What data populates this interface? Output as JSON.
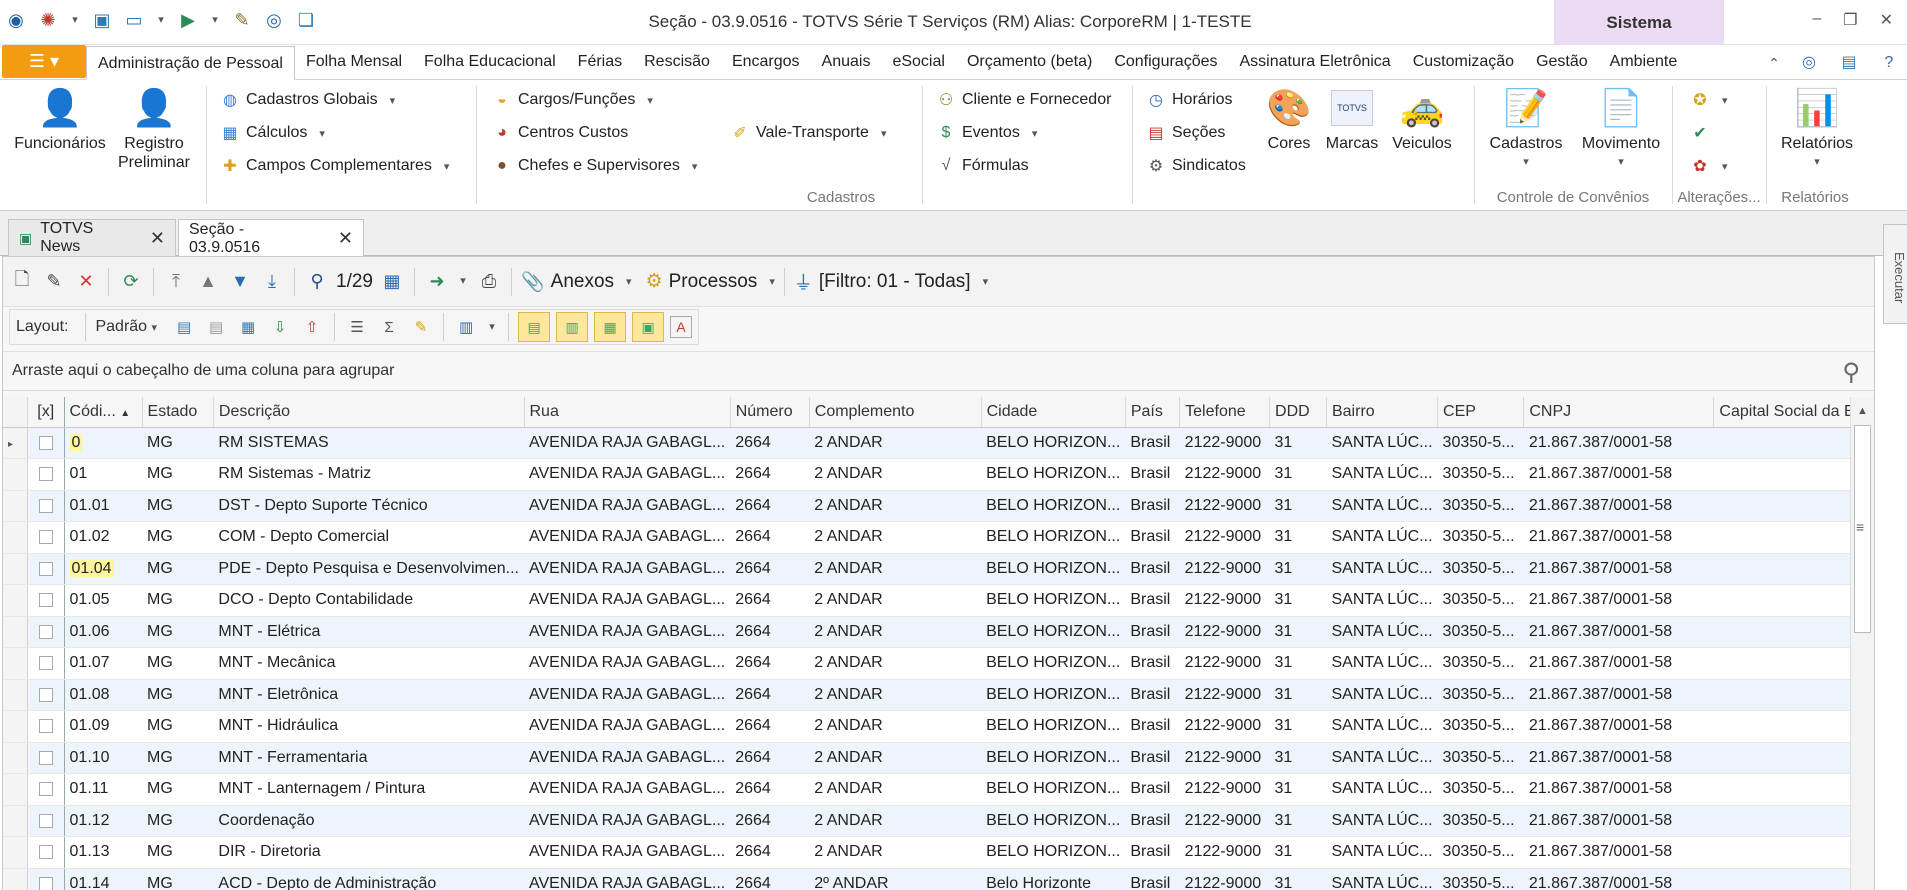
{
  "window": {
    "title": "Seção - 03.9.0516 - TOTVS Série T Serviços (RM) Alias: CorporeRM | 1-TESTE",
    "context_tab": "Sistema",
    "controls": [
      "–",
      "❐",
      "✕"
    ]
  },
  "ribbon_tabs": [
    {
      "label": "Administração de Pessoal",
      "active": true
    },
    {
      "label": "Folha Mensal"
    },
    {
      "label": "Folha Educacional"
    },
    {
      "label": "Férias"
    },
    {
      "label": "Rescisão"
    },
    {
      "label": "Encargos"
    },
    {
      "label": "Anuais"
    },
    {
      "label": "eSocial"
    },
    {
      "label": "Orçamento (beta)"
    },
    {
      "label": "Configurações"
    },
    {
      "label": "Assinatura Eletrônica"
    },
    {
      "label": "Customização"
    },
    {
      "label": "Gestão"
    },
    {
      "label": "Ambiente"
    }
  ],
  "ribbon": {
    "funcionarios": "Funcionários",
    "registro": "Registro\nPreliminar",
    "cadastros_globais": "Cadastros Globais",
    "calculos": "Cálculos",
    "campos_complementares": "Campos Complementares",
    "cargos_funcoes": "Cargos/Funções",
    "centros_custos": "Centros Custos",
    "chefes_supervisores": "Chefes e Supervisores",
    "vale_transporte": "Vale-Transporte",
    "cliente_fornecedor": "Cliente e Fornecedor",
    "eventos": "Eventos",
    "formulas": "Fórmulas",
    "horarios": "Horários",
    "secoes": "Seções",
    "sindicatos": "Sindicatos",
    "cores": "Cores",
    "marcas": "Marcas",
    "veiculos": "Veiculos",
    "marcas_logo": "TOTVS",
    "group_cadastros": "Cadastros",
    "cadastros_btn": "Cadastros",
    "movimento_btn": "Movimento",
    "group_convenios": "Controle de Convênios",
    "group_alteracoes": "Alterações...",
    "relatorios_btn": "Relatórios",
    "group_relatorios": "Relatórios"
  },
  "doc_tabs": [
    {
      "label": "TOTVS News",
      "active": false
    },
    {
      "label": "Seção - 03.9.0516",
      "active": true
    }
  ],
  "side_panel": "Executar",
  "toolbar": {
    "pager": "1/29",
    "anexos": "Anexos",
    "processos": "Processos",
    "filtro": "[Filtro: 01 - Todas]",
    "layout_label": "Layout:",
    "layout_value": "Padrão"
  },
  "group_prompt": "Arraste aqui o cabeçalho de uma coluna para agrupar",
  "grid": {
    "columns": [
      "[x]",
      "Códi...",
      "Estado",
      "Descrição",
      "Rua",
      "Número",
      "Complemento",
      "Cidade",
      "País",
      "Telefone",
      "DDD",
      "Bairro",
      "CEP",
      "CNPJ",
      "Capital Social da Em"
    ],
    "rows": [
      {
        "codigo": "0",
        "estado": "MG",
        "descricao": "RM SISTEMAS",
        "rua": "AVENIDA RAJA GABAGL...",
        "numero": "2664",
        "complemento": "2 ANDAR",
        "cidade": "BELO HORIZON...",
        "pais": "Brasil",
        "telefone": "2122-9000",
        "ddd": "31",
        "bairro": "SANTA LÚC...",
        "cep": "30350-5...",
        "cnpj": "21.867.387/0001-58",
        "highlight": true,
        "current": true
      },
      {
        "codigo": "01",
        "estado": "MG",
        "descricao": "RM Sistemas - Matriz",
        "rua": "AVENIDA RAJA GABAGL...",
        "numero": "2664",
        "complemento": "2 ANDAR",
        "cidade": "BELO HORIZON...",
        "pais": "Brasil",
        "telefone": "2122-9000",
        "ddd": "31",
        "bairro": "SANTA LÚC...",
        "cep": "30350-5...",
        "cnpj": "21.867.387/0001-58"
      },
      {
        "codigo": "01.01",
        "estado": "MG",
        "descricao": "DST - Depto Suporte Técnico",
        "rua": "AVENIDA RAJA GABAGL...",
        "numero": "2664",
        "complemento": "2 ANDAR",
        "cidade": "BELO HORIZON...",
        "pais": "Brasil",
        "telefone": "2122-9000",
        "ddd": "31",
        "bairro": "SANTA LÚC...",
        "cep": "30350-5...",
        "cnpj": "21.867.387/0001-58"
      },
      {
        "codigo": "01.02",
        "estado": "MG",
        "descricao": "COM - Depto Comercial",
        "rua": "AVENIDA RAJA GABAGL...",
        "numero": "2664",
        "complemento": "2 ANDAR",
        "cidade": "BELO HORIZON...",
        "pais": "Brasil",
        "telefone": "2122-9000",
        "ddd": "31",
        "bairro": "SANTA LÚC...",
        "cep": "30350-5...",
        "cnpj": "21.867.387/0001-58"
      },
      {
        "codigo": "01.04",
        "estado": "MG",
        "descricao": "PDE - Depto Pesquisa e Desenvolvimen...",
        "rua": "AVENIDA RAJA GABAGL...",
        "numero": "2664",
        "complemento": "2 ANDAR",
        "cidade": "BELO HORIZON...",
        "pais": "Brasil",
        "telefone": "2122-9000",
        "ddd": "31",
        "bairro": "SANTA LÚC...",
        "cep": "30350-5...",
        "cnpj": "21.867.387/0001-58",
        "highlight": true
      },
      {
        "codigo": "01.05",
        "estado": "MG",
        "descricao": "DCO - Depto Contabilidade",
        "rua": "AVENIDA RAJA GABAGL...",
        "numero": "2664",
        "complemento": "2 ANDAR",
        "cidade": "BELO HORIZON...",
        "pais": "Brasil",
        "telefone": "2122-9000",
        "ddd": "31",
        "bairro": "SANTA LÚC...",
        "cep": "30350-5...",
        "cnpj": "21.867.387/0001-58"
      },
      {
        "codigo": "01.06",
        "estado": "MG",
        "descricao": "MNT - Elétrica",
        "rua": "AVENIDA RAJA GABAGL...",
        "numero": "2664",
        "complemento": "2 ANDAR",
        "cidade": "BELO HORIZON...",
        "pais": "Brasil",
        "telefone": "2122-9000",
        "ddd": "31",
        "bairro": "SANTA LÚC...",
        "cep": "30350-5...",
        "cnpj": "21.867.387/0001-58"
      },
      {
        "codigo": "01.07",
        "estado": "MG",
        "descricao": "MNT - Mecânica",
        "rua": "AVENIDA RAJA GABAGL...",
        "numero": "2664",
        "complemento": "2 ANDAR",
        "cidade": "BELO HORIZON...",
        "pais": "Brasil",
        "telefone": "2122-9000",
        "ddd": "31",
        "bairro": "SANTA LÚC...",
        "cep": "30350-5...",
        "cnpj": "21.867.387/0001-58"
      },
      {
        "codigo": "01.08",
        "estado": "MG",
        "descricao": "MNT - Eletrônica",
        "rua": "AVENIDA RAJA GABAGL...",
        "numero": "2664",
        "complemento": "2 ANDAR",
        "cidade": "BELO HORIZON...",
        "pais": "Brasil",
        "telefone": "2122-9000",
        "ddd": "31",
        "bairro": "SANTA LÚC...",
        "cep": "30350-5...",
        "cnpj": "21.867.387/0001-58"
      },
      {
        "codigo": "01.09",
        "estado": "MG",
        "descricao": "MNT - Hidráulica",
        "rua": "AVENIDA RAJA GABAGL...",
        "numero": "2664",
        "complemento": "2 ANDAR",
        "cidade": "BELO HORIZON...",
        "pais": "Brasil",
        "telefone": "2122-9000",
        "ddd": "31",
        "bairro": "SANTA LÚC...",
        "cep": "30350-5...",
        "cnpj": "21.867.387/0001-58"
      },
      {
        "codigo": "01.10",
        "estado": "MG",
        "descricao": "MNT - Ferramentaria",
        "rua": "AVENIDA RAJA GABAGL...",
        "numero": "2664",
        "complemento": "2 ANDAR",
        "cidade": "BELO HORIZON...",
        "pais": "Brasil",
        "telefone": "2122-9000",
        "ddd": "31",
        "bairro": "SANTA LÚC...",
        "cep": "30350-5...",
        "cnpj": "21.867.387/0001-58"
      },
      {
        "codigo": "01.11",
        "estado": "MG",
        "descricao": "MNT - Lanternagem / Pintura",
        "rua": "AVENIDA RAJA GABAGL...",
        "numero": "2664",
        "complemento": "2 ANDAR",
        "cidade": "BELO HORIZON...",
        "pais": "Brasil",
        "telefone": "2122-9000",
        "ddd": "31",
        "bairro": "SANTA LÚC...",
        "cep": "30350-5...",
        "cnpj": "21.867.387/0001-58"
      },
      {
        "codigo": "01.12",
        "estado": "MG",
        "descricao": "Coordenação",
        "rua": "AVENIDA RAJA GABAGL...",
        "numero": "2664",
        "complemento": "2 ANDAR",
        "cidade": "BELO HORIZON...",
        "pais": "Brasil",
        "telefone": "2122-9000",
        "ddd": "31",
        "bairro": "SANTA LÚC...",
        "cep": "30350-5...",
        "cnpj": "21.867.387/0001-58"
      },
      {
        "codigo": "01.13",
        "estado": "MG",
        "descricao": "DIR - Diretoria",
        "rua": "AVENIDA RAJA GABAGL...",
        "numero": "2664",
        "complemento": "2 ANDAR",
        "cidade": "BELO HORIZON...",
        "pais": "Brasil",
        "telefone": "2122-9000",
        "ddd": "31",
        "bairro": "SANTA LÚC...",
        "cep": "30350-5...",
        "cnpj": "21.867.387/0001-58"
      },
      {
        "codigo": "01.14",
        "estado": "MG",
        "descricao": "ACD - Depto de Administração",
        "rua": "AVENIDA RAJA GABAGL...",
        "numero": "2664",
        "complemento": "2º ANDAR",
        "cidade": "Belo Horizonte",
        "pais": "Brasil",
        "telefone": "2122-9000",
        "ddd": "31",
        "bairro": "SANTA LÚC...",
        "cep": "30350-5...",
        "cnpj": "21.867.387/0001-58"
      }
    ]
  },
  "colors": {
    "app_button": "#f39c12",
    "context_tab": "#ecdcf3",
    "alt_row": "#eef4fb",
    "highlight": "#fff59d"
  }
}
